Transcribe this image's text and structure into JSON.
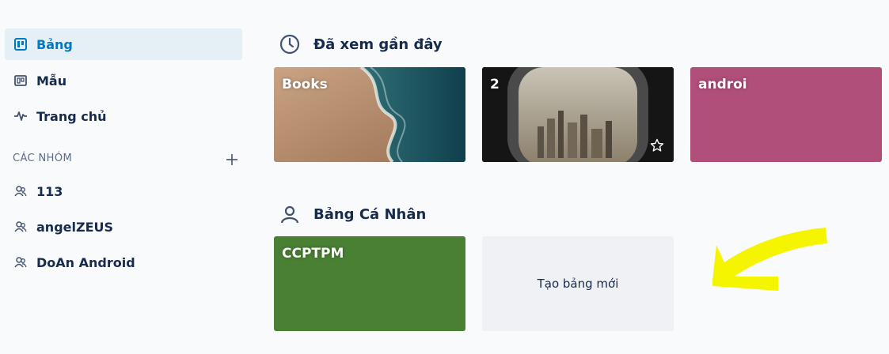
{
  "sidebar": {
    "nav": [
      {
        "label": "Bảng",
        "icon": "board-icon",
        "active": true
      },
      {
        "label": "Mẫu",
        "icon": "template-icon",
        "active": false
      },
      {
        "label": "Trang chủ",
        "icon": "activity-icon",
        "active": false
      }
    ],
    "teams_heading": "CÁC NHÓM",
    "teams": [
      {
        "label": "113",
        "icon": "team-icon"
      },
      {
        "label": "angelZEUS",
        "icon": "team-icon"
      },
      {
        "label": "DoAn Android",
        "icon": "team-icon"
      }
    ]
  },
  "recent": {
    "heading": "Đã xem gần đây",
    "icon": "clock-icon",
    "boards": [
      {
        "title": "Books",
        "background": "beach-photo"
      },
      {
        "title": "2",
        "background": "airplane-window-photo"
      },
      {
        "title": "androi",
        "background": "#b04f7a"
      }
    ]
  },
  "personal": {
    "heading": "Bảng Cá Nhân",
    "icon": "person-icon",
    "boards": [
      {
        "title": "CCPTPM",
        "background": "#4a8033"
      }
    ],
    "create_label": "Tạo bảng mới"
  },
  "colors": {
    "accent": "#0079bf",
    "active_bg": "#e4f0f6",
    "annotation_arrow": "#f5f500"
  }
}
